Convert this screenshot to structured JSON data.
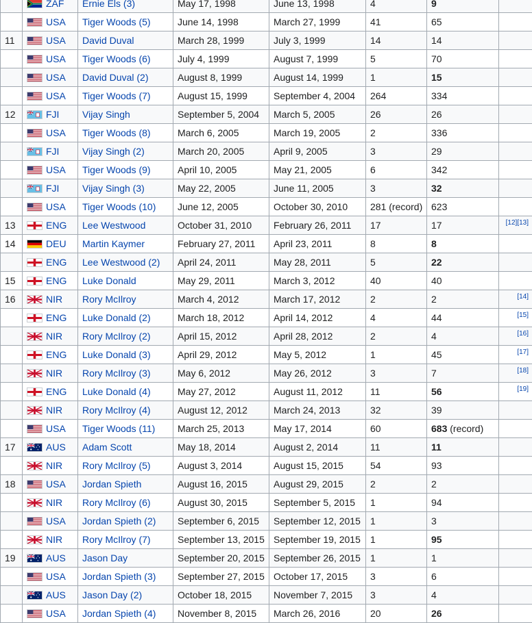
{
  "table": {
    "rows": [
      {
        "no": "",
        "flag": "zaf",
        "country": "ZAF",
        "player": "Ernie Els (3)",
        "start": "May 17, 1998",
        "end": "June 13, 1998",
        "weeks": "4",
        "total": "9",
        "total_bold": true,
        "total_note": "",
        "ref": ""
      },
      {
        "no": "",
        "flag": "usa",
        "country": "USA",
        "player": "Tiger Woods (5)",
        "start": "June 14, 1998",
        "end": "March 27, 1999",
        "weeks": "41",
        "total": "65",
        "total_bold": false,
        "total_note": "",
        "ref": ""
      },
      {
        "no": "11",
        "flag": "usa",
        "country": "USA",
        "player": "David Duval",
        "start": "March 28, 1999",
        "end": "July 3, 1999",
        "weeks": "14",
        "total": "14",
        "total_bold": false,
        "total_note": "",
        "ref": ""
      },
      {
        "no": "",
        "flag": "usa",
        "country": "USA",
        "player": "Tiger Woods (6)",
        "start": "July 4, 1999",
        "end": "August 7, 1999",
        "weeks": "5",
        "total": "70",
        "total_bold": false,
        "total_note": "",
        "ref": ""
      },
      {
        "no": "",
        "flag": "usa",
        "country": "USA",
        "player": "David Duval (2)",
        "start": "August 8, 1999",
        "end": "August 14, 1999",
        "weeks": "1",
        "total": "15",
        "total_bold": true,
        "total_note": "",
        "ref": ""
      },
      {
        "no": "",
        "flag": "usa",
        "country": "USA",
        "player": "Tiger Woods (7)",
        "start": "August 15, 1999",
        "end": "September 4, 2004",
        "weeks": "264",
        "total": "334",
        "total_bold": false,
        "total_note": "",
        "ref": ""
      },
      {
        "no": "12",
        "flag": "fji",
        "country": "FJI",
        "player": "Vijay Singh",
        "start": "September 5, 2004",
        "end": "March 5, 2005",
        "weeks": "26",
        "total": "26",
        "total_bold": false,
        "total_note": "",
        "ref": ""
      },
      {
        "no": "",
        "flag": "usa",
        "country": "USA",
        "player": "Tiger Woods (8)",
        "start": "March 6, 2005",
        "end": "March 19, 2005",
        "weeks": "2",
        "total": "336",
        "total_bold": false,
        "total_note": "",
        "ref": ""
      },
      {
        "no": "",
        "flag": "fji",
        "country": "FJI",
        "player": "Vijay Singh (2)",
        "start": "March 20, 2005",
        "end": "April 9, 2005",
        "weeks": "3",
        "total": "29",
        "total_bold": false,
        "total_note": "",
        "ref": ""
      },
      {
        "no": "",
        "flag": "usa",
        "country": "USA",
        "player": "Tiger Woods (9)",
        "start": "April 10, 2005",
        "end": "May 21, 2005",
        "weeks": "6",
        "total": "342",
        "total_bold": false,
        "total_note": "",
        "ref": ""
      },
      {
        "no": "",
        "flag": "fji",
        "country": "FJI",
        "player": "Vijay Singh (3)",
        "start": "May 22, 2005",
        "end": "June 11, 2005",
        "weeks": "3",
        "total": "32",
        "total_bold": true,
        "total_note": "",
        "ref": ""
      },
      {
        "no": "",
        "flag": "usa",
        "country": "USA",
        "player": "Tiger Woods (10)",
        "start": "June 12, 2005",
        "end": "October 30, 2010",
        "weeks": "281 (record)",
        "total": "623",
        "total_bold": false,
        "total_note": "",
        "ref": ""
      },
      {
        "no": "13",
        "flag": "eng",
        "country": "ENG",
        "player": "Lee Westwood",
        "start": "October 31, 2010",
        "end": "February 26, 2011",
        "weeks": "17",
        "total": "17",
        "total_bold": false,
        "total_note": "",
        "ref": "[12][13]"
      },
      {
        "no": "14",
        "flag": "deu",
        "country": "DEU",
        "player": "Martin Kaymer",
        "start": "February 27, 2011",
        "end": "April 23, 2011",
        "weeks": "8",
        "total": "8",
        "total_bold": true,
        "total_note": "",
        "ref": ""
      },
      {
        "no": "",
        "flag": "eng",
        "country": "ENG",
        "player": "Lee Westwood (2)",
        "start": "April 24, 2011",
        "end": "May 28, 2011",
        "weeks": "5",
        "total": "22",
        "total_bold": true,
        "total_note": "",
        "ref": ""
      },
      {
        "no": "15",
        "flag": "eng",
        "country": "ENG",
        "player": "Luke Donald",
        "start": "May 29, 2011",
        "end": "March 3, 2012",
        "weeks": "40",
        "total": "40",
        "total_bold": false,
        "total_note": "",
        "ref": ""
      },
      {
        "no": "16",
        "flag": "nir",
        "country": "NIR",
        "player": "Rory McIlroy",
        "start": "March 4, 2012",
        "end": "March 17, 2012",
        "weeks": "2",
        "total": "2",
        "total_bold": false,
        "total_note": "",
        "ref": "[14]"
      },
      {
        "no": "",
        "flag": "eng",
        "country": "ENG",
        "player": "Luke Donald (2)",
        "start": "March 18, 2012",
        "end": "April 14, 2012",
        "weeks": "4",
        "total": "44",
        "total_bold": false,
        "total_note": "",
        "ref": "[15]"
      },
      {
        "no": "",
        "flag": "nir",
        "country": "NIR",
        "player": "Rory McIlroy (2)",
        "start": "April 15, 2012",
        "end": "April 28, 2012",
        "weeks": "2",
        "total": "4",
        "total_bold": false,
        "total_note": "",
        "ref": "[16]"
      },
      {
        "no": "",
        "flag": "eng",
        "country": "ENG",
        "player": "Luke Donald (3)",
        "start": "April 29, 2012",
        "end": "May 5, 2012",
        "weeks": "1",
        "total": "45",
        "total_bold": false,
        "total_note": "",
        "ref": "[17]"
      },
      {
        "no": "",
        "flag": "nir",
        "country": "NIR",
        "player": "Rory McIlroy (3)",
        "start": "May 6, 2012",
        "end": "May 26, 2012",
        "weeks": "3",
        "total": "7",
        "total_bold": false,
        "total_note": "",
        "ref": "[18]"
      },
      {
        "no": "",
        "flag": "eng",
        "country": "ENG",
        "player": "Luke Donald (4)",
        "start": "May 27, 2012",
        "end": "August 11, 2012",
        "weeks": "11",
        "total": "56",
        "total_bold": true,
        "total_note": "",
        "ref": "[19]"
      },
      {
        "no": "",
        "flag": "nir",
        "country": "NIR",
        "player": "Rory McIlroy (4)",
        "start": "August 12, 2012",
        "end": "March 24, 2013",
        "weeks": "32",
        "total": "39",
        "total_bold": false,
        "total_note": "",
        "ref": ""
      },
      {
        "no": "",
        "flag": "usa",
        "country": "USA",
        "player": "Tiger Woods (11)",
        "start": "March 25, 2013",
        "end": "May 17, 2014",
        "weeks": "60",
        "total": "683",
        "total_bold": true,
        "total_note": " (record)",
        "ref": ""
      },
      {
        "no": "17",
        "flag": "aus",
        "country": "AUS",
        "player": "Adam Scott",
        "start": "May 18, 2014",
        "end": "August 2, 2014",
        "weeks": "11",
        "total": "11",
        "total_bold": true,
        "total_note": "",
        "ref": ""
      },
      {
        "no": "",
        "flag": "nir",
        "country": "NIR",
        "player": "Rory McIlroy (5)",
        "start": "August 3, 2014",
        "end": "August 15, 2015",
        "weeks": "54",
        "total": "93",
        "total_bold": false,
        "total_note": "",
        "ref": ""
      },
      {
        "no": "18",
        "flag": "usa",
        "country": "USA",
        "player": "Jordan Spieth",
        "start": "August 16, 2015",
        "end": "August 29, 2015",
        "weeks": "2",
        "total": "2",
        "total_bold": false,
        "total_note": "",
        "ref": ""
      },
      {
        "no": "",
        "flag": "nir",
        "country": "NIR",
        "player": "Rory McIlroy (6)",
        "start": "August 30, 2015",
        "end": "September 5, 2015",
        "weeks": "1",
        "total": "94",
        "total_bold": false,
        "total_note": "",
        "ref": ""
      },
      {
        "no": "",
        "flag": "usa",
        "country": "USA",
        "player": "Jordan Spieth (2)",
        "start": "September 6, 2015",
        "end": "September 12, 2015",
        "weeks": "1",
        "total": "3",
        "total_bold": false,
        "total_note": "",
        "ref": ""
      },
      {
        "no": "",
        "flag": "nir",
        "country": "NIR",
        "player": "Rory McIlroy (7)",
        "start": "September 13, 2015",
        "end": "September 19, 2015",
        "weeks": "1",
        "total": "95",
        "total_bold": true,
        "total_note": "",
        "ref": ""
      },
      {
        "no": "19",
        "flag": "aus",
        "country": "AUS",
        "player": "Jason Day",
        "start": "September 20, 2015",
        "end": "September 26, 2015",
        "weeks": "1",
        "total": "1",
        "total_bold": false,
        "total_note": "",
        "ref": ""
      },
      {
        "no": "",
        "flag": "usa",
        "country": "USA",
        "player": "Jordan Spieth (3)",
        "start": "September 27, 2015",
        "end": "October 17, 2015",
        "weeks": "3",
        "total": "6",
        "total_bold": false,
        "total_note": "",
        "ref": ""
      },
      {
        "no": "",
        "flag": "aus",
        "country": "AUS",
        "player": "Jason Day (2)",
        "start": "October 18, 2015",
        "end": "November 7, 2015",
        "weeks": "3",
        "total": "4",
        "total_bold": false,
        "total_note": "",
        "ref": ""
      },
      {
        "no": "",
        "flag": "usa",
        "country": "USA",
        "player": "Jordan Spieth (4)",
        "start": "November 8, 2015",
        "end": "March 26, 2016",
        "weeks": "20",
        "total": "26",
        "total_bold": true,
        "total_note": "",
        "ref": ""
      }
    ]
  },
  "flag_icons": {
    "usa": "usa-flag-icon",
    "zaf": "south-africa-flag-icon",
    "fji": "fiji-flag-icon",
    "eng": "england-flag-icon",
    "deu": "germany-flag-icon",
    "nir": "northern-ireland-flag-icon",
    "aus": "australia-flag-icon"
  },
  "colors": {
    "link": "#0645ad",
    "border": "#a2a9b1",
    "row_alt": "#f8f9fa",
    "text": "#202122"
  }
}
